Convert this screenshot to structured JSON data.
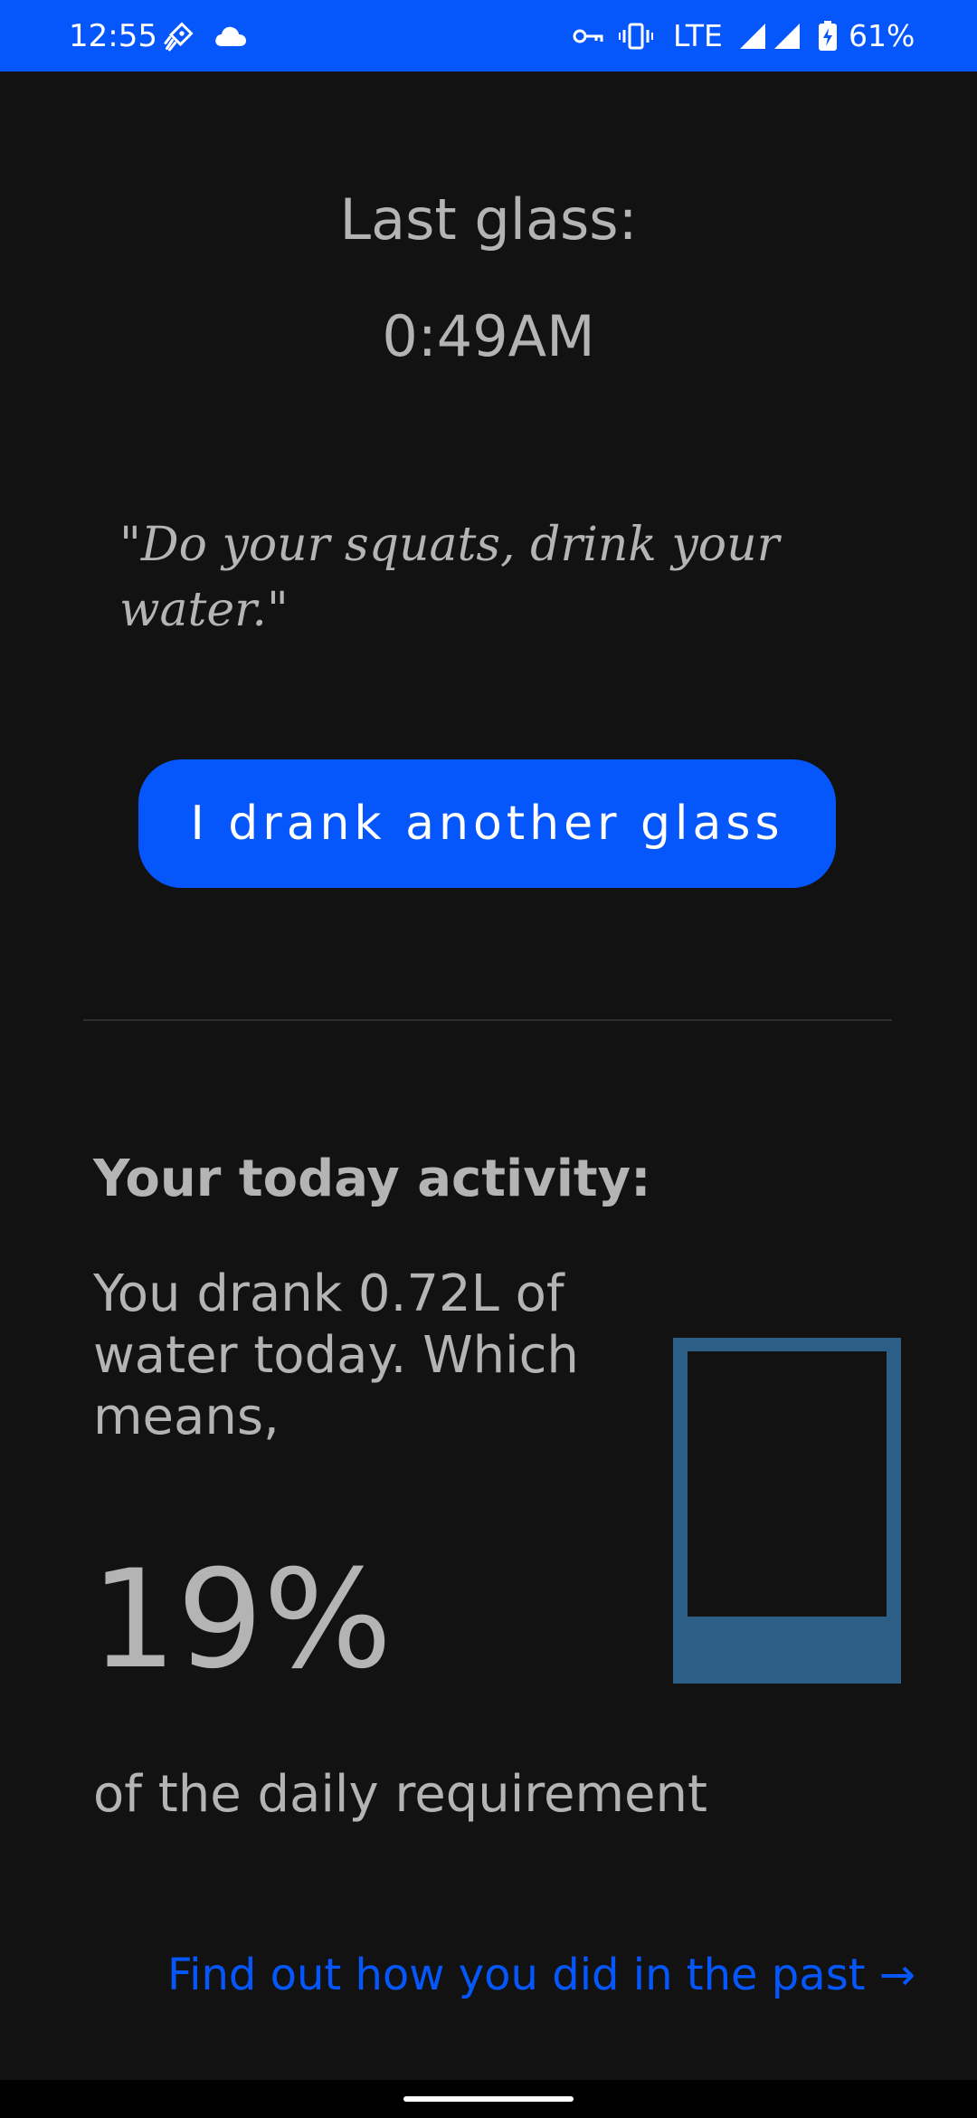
{
  "status_bar": {
    "time": "12:55",
    "network": "LTE",
    "battery": "61%",
    "icons": [
      "rocket-icon",
      "cloud-icon",
      "vpn-key-icon",
      "vibrate-icon",
      "signal-icon",
      "signal-icon",
      "battery-charging-icon"
    ],
    "background_color": "#0557fb"
  },
  "last_glass": {
    "label": "Last glass:",
    "time": "0:49AM"
  },
  "quote": "\"Do your squats, drink your water.\"",
  "actions": {
    "drink_button_label": "I drank another glass"
  },
  "activity": {
    "heading": "Your today activity:",
    "summary": "You drank 0.72L of water today. Which means,",
    "percent": "19%",
    "percent_value": 19,
    "requirement_text": "of the daily requirement"
  },
  "past_link_label": "Find out how you did in the past →",
  "colors": {
    "accent": "#0557fb",
    "water": "#2d5f86",
    "background": "#121212",
    "text": "#b4b4b4"
  }
}
